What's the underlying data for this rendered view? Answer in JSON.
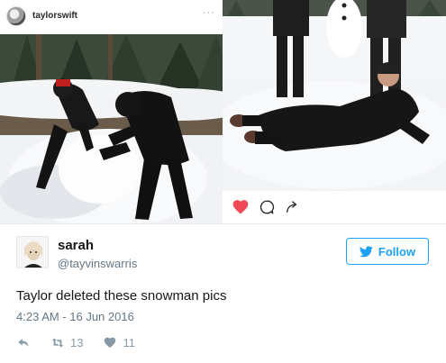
{
  "instagram": {
    "username": "taylorswift",
    "more_glyph": "···",
    "icons": [
      "heart-icon",
      "comment-icon",
      "share-icon"
    ],
    "liked_color": "#ed4956"
  },
  "tweet": {
    "display_name": "sarah",
    "handle": "@tayvinswarris",
    "follow_label": "Follow",
    "text": "Taylor deleted these snowman pics",
    "timestamp": "4:23 AM - 16 Jun 2016",
    "retweets": "13",
    "likes": "11",
    "accent_color": "#1da1f2"
  }
}
